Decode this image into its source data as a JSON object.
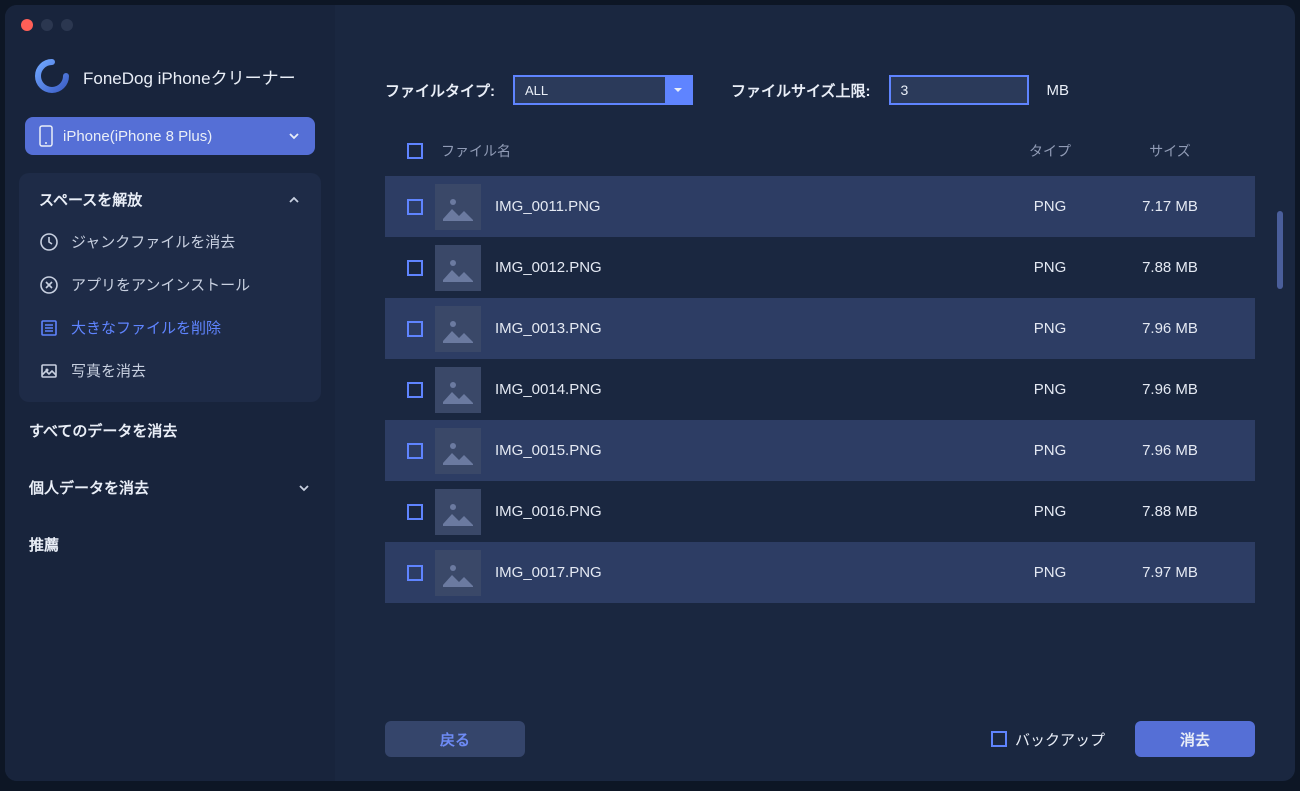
{
  "app_title": "FoneDog iPhoneクリーナー",
  "device": {
    "label": "iPhone(iPhone 8 Plus)"
  },
  "sidebar": {
    "section_free_space": "スペースを解放",
    "items": [
      {
        "icon": "clock-icon",
        "label": "ジャンクファイルを消去"
      },
      {
        "icon": "x-circle-icon",
        "label": "アプリをアンインストール"
      },
      {
        "icon": "list-icon",
        "label": "大きなファイルを削除",
        "active": true
      },
      {
        "icon": "photo-icon",
        "label": "写真を消去"
      }
    ],
    "erase_all": "すべてのデータを消去",
    "erase_private": "個人データを消去",
    "recommend": "推薦"
  },
  "filters": {
    "file_type_label": "ファイルタイプ:",
    "file_type_value": "ALL",
    "size_limit_label": "ファイルサイズ上限:",
    "size_limit_value": "3",
    "size_unit": "MB"
  },
  "columns": {
    "name": "ファイル名",
    "type": "タイプ",
    "size": "サイズ"
  },
  "files": [
    {
      "name": "IMG_0011.PNG",
      "type": "PNG",
      "size": "7.17 MB"
    },
    {
      "name": "IMG_0012.PNG",
      "type": "PNG",
      "size": "7.88 MB"
    },
    {
      "name": "IMG_0013.PNG",
      "type": "PNG",
      "size": "7.96 MB"
    },
    {
      "name": "IMG_0014.PNG",
      "type": "PNG",
      "size": "7.96 MB"
    },
    {
      "name": "IMG_0015.PNG",
      "type": "PNG",
      "size": "7.96 MB"
    },
    {
      "name": "IMG_0016.PNG",
      "type": "PNG",
      "size": "7.88 MB"
    },
    {
      "name": "IMG_0017.PNG",
      "type": "PNG",
      "size": "7.97 MB"
    }
  ],
  "footer": {
    "back": "戻る",
    "backup": "バックアップ",
    "erase": "消去"
  }
}
